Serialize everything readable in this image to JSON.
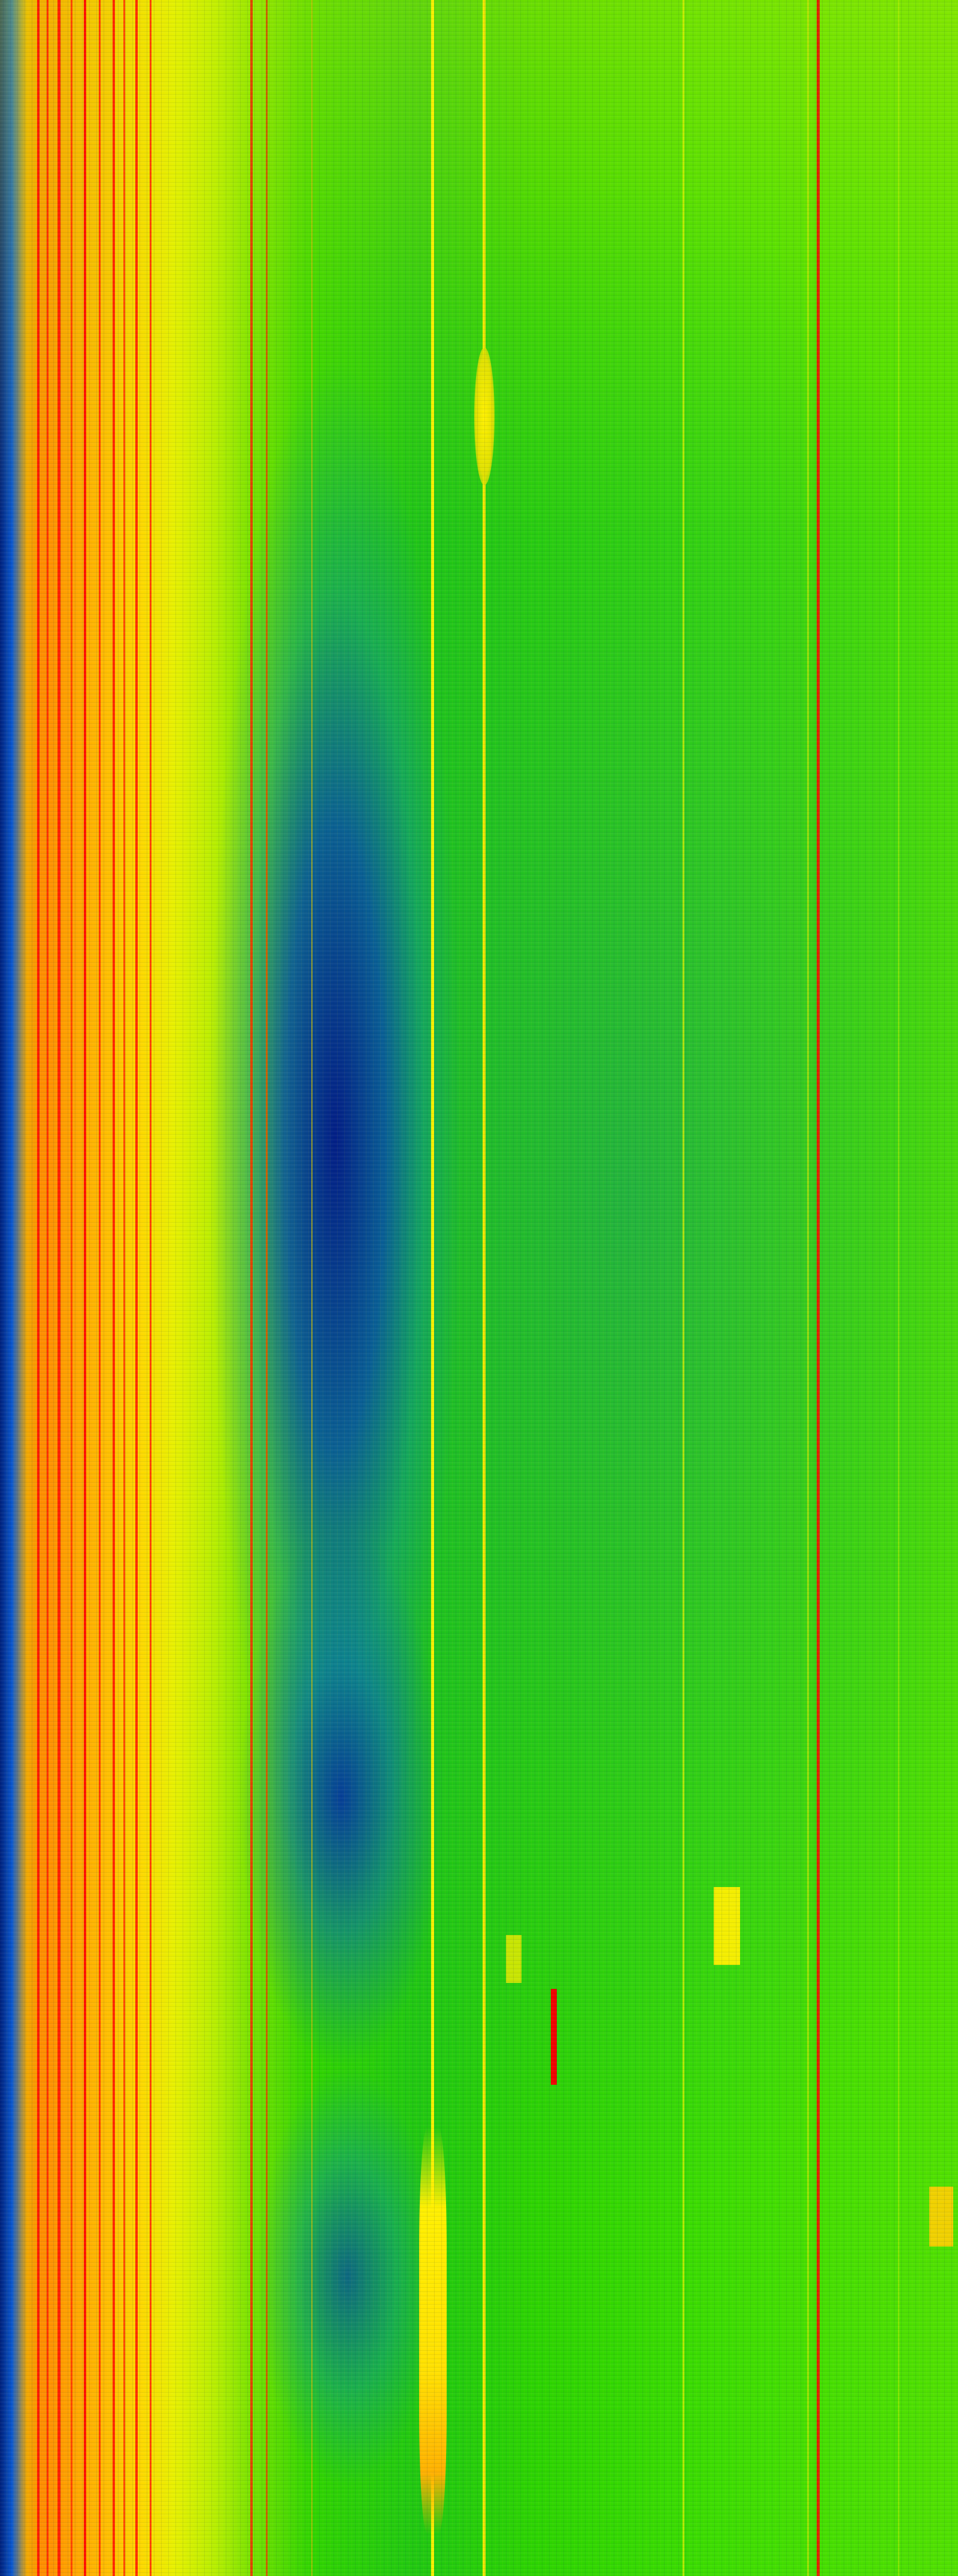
{
  "image": {
    "kind": "spectrogram waterfall",
    "colormap": [
      "#000080",
      "#0040ff",
      "#00c0ff",
      "#00e000",
      "#c0ff00",
      "#ffff00",
      "#ff8000",
      "#ff0000"
    ],
    "text": []
  }
}
